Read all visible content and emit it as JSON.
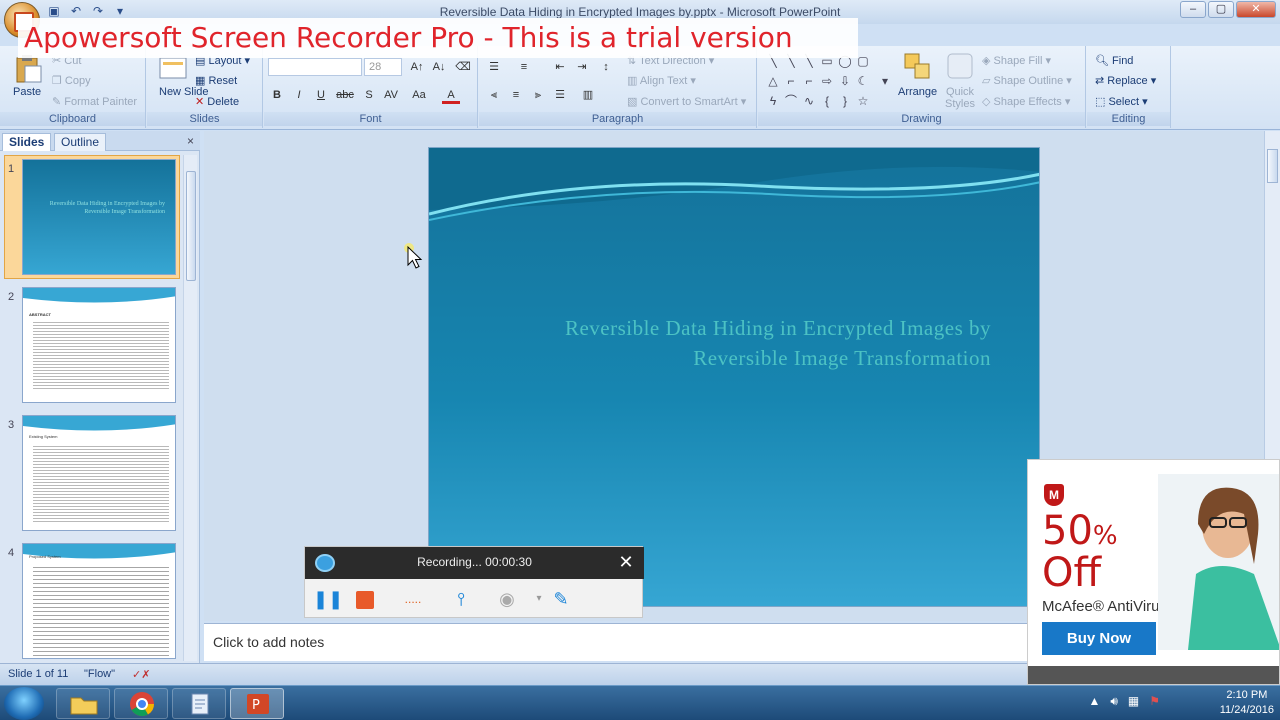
{
  "window": {
    "title": "Reversible Data Hiding in Encrypted Images by.pptx - Microsoft PowerPoint",
    "controls": [
      "–",
      "▢",
      "✕"
    ]
  },
  "watermark": "Apowersoft Screen Recorder Pro - This is a trial version",
  "ribbon": {
    "clipboard": {
      "label": "Clipboard",
      "paste": "Paste",
      "cut": "Cut",
      "copy": "Copy",
      "format_painter": "Format Painter"
    },
    "slides": {
      "label": "Slides",
      "new_slide": "New Slide",
      "layout": "Layout",
      "reset": "Reset",
      "delete": "Delete"
    },
    "font": {
      "label": "Font",
      "size": "28",
      "buttons": [
        "B",
        "I",
        "U",
        "abc",
        "S",
        "AV",
        "Aa",
        "A"
      ]
    },
    "paragraph": {
      "label": "Paragraph",
      "text_direction": "Text Direction",
      "align_text": "Align Text",
      "convert_smartart": "Convert to SmartArt"
    },
    "drawing": {
      "label": "Drawing",
      "arrange": "Arrange",
      "quick_styles": "Quick Styles",
      "shape_fill": "Shape Fill",
      "shape_outline": "Shape Outline",
      "shape_effects": "Shape Effects"
    },
    "editing": {
      "label": "Editing",
      "find": "Find",
      "replace": "Replace",
      "select": "Select"
    }
  },
  "left_pane": {
    "tabs": [
      "Slides",
      "Outline"
    ],
    "close": "×",
    "thumbnails": [
      {
        "number": "1",
        "title": "Reversible Data Hiding in Encrypted Images by Reversible Image Transformation"
      },
      {
        "number": "2",
        "title": "ABSTRACT"
      },
      {
        "number": "3",
        "title": "Existing System"
      },
      {
        "number": "4",
        "title": "Proposed System"
      }
    ]
  },
  "slide": {
    "title_line1": "Reversible Data Hiding in Encrypted Images by",
    "title_line2": "Reversible Image Transformation"
  },
  "notes": {
    "placeholder": "Click to add notes"
  },
  "status_bar": {
    "slide_info": "Slide 1 of 11",
    "theme": "\"Flow\""
  },
  "recorder": {
    "status": "Recording... 00:00:30",
    "close": "✕"
  },
  "ad": {
    "brand_mark": "M",
    "percent": "50",
    "percent_sign": "%",
    "off": "Off",
    "product": "McAfee® AntiVirus",
    "cta": "Buy Now"
  },
  "taskbar": {
    "time": "2:10 PM",
    "date": "11/24/2016"
  },
  "colors": {
    "slide_bg": "#1786b1",
    "title_text": "#4cc2c4",
    "watermark_text": "#e0242b",
    "ad_red": "#c01818",
    "ad_button": "#1878c8"
  }
}
